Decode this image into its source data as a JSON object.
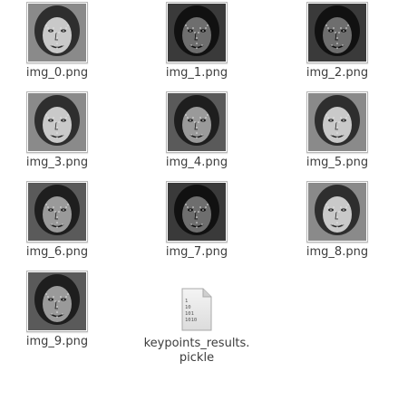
{
  "files": [
    {
      "name": "img_0.png",
      "type": "image",
      "icon": "face-thumbnail-icon",
      "tone": "light"
    },
    {
      "name": "img_1.png",
      "type": "image",
      "icon": "face-thumbnail-icon",
      "tone": "dark"
    },
    {
      "name": "img_2.png",
      "type": "image",
      "icon": "face-thumbnail-icon",
      "tone": "dark"
    },
    {
      "name": "img_3.png",
      "type": "image",
      "icon": "face-thumbnail-icon",
      "tone": "light"
    },
    {
      "name": "img_4.png",
      "type": "image",
      "icon": "face-thumbnail-icon",
      "tone": "mid"
    },
    {
      "name": "img_5.png",
      "type": "image",
      "icon": "face-thumbnail-icon",
      "tone": "light"
    },
    {
      "name": "img_6.png",
      "type": "image",
      "icon": "face-thumbnail-icon",
      "tone": "mid"
    },
    {
      "name": "img_7.png",
      "type": "image",
      "icon": "face-thumbnail-icon",
      "tone": "dark"
    },
    {
      "name": "img_8.png",
      "type": "image",
      "icon": "face-thumbnail-icon",
      "tone": "light"
    },
    {
      "name": "img_9.png",
      "type": "image",
      "icon": "face-thumbnail-icon",
      "tone": "mid"
    },
    {
      "name": "keypoints_results.\npickle",
      "type": "binary",
      "icon": "binary-file-icon",
      "icon_text": [
        "1",
        "10",
        "101",
        "1010"
      ]
    }
  ],
  "colors": {
    "label": "#3c3c3c",
    "thumb_border": "#b8b8b8",
    "keypoint": "#e8e8e8"
  }
}
